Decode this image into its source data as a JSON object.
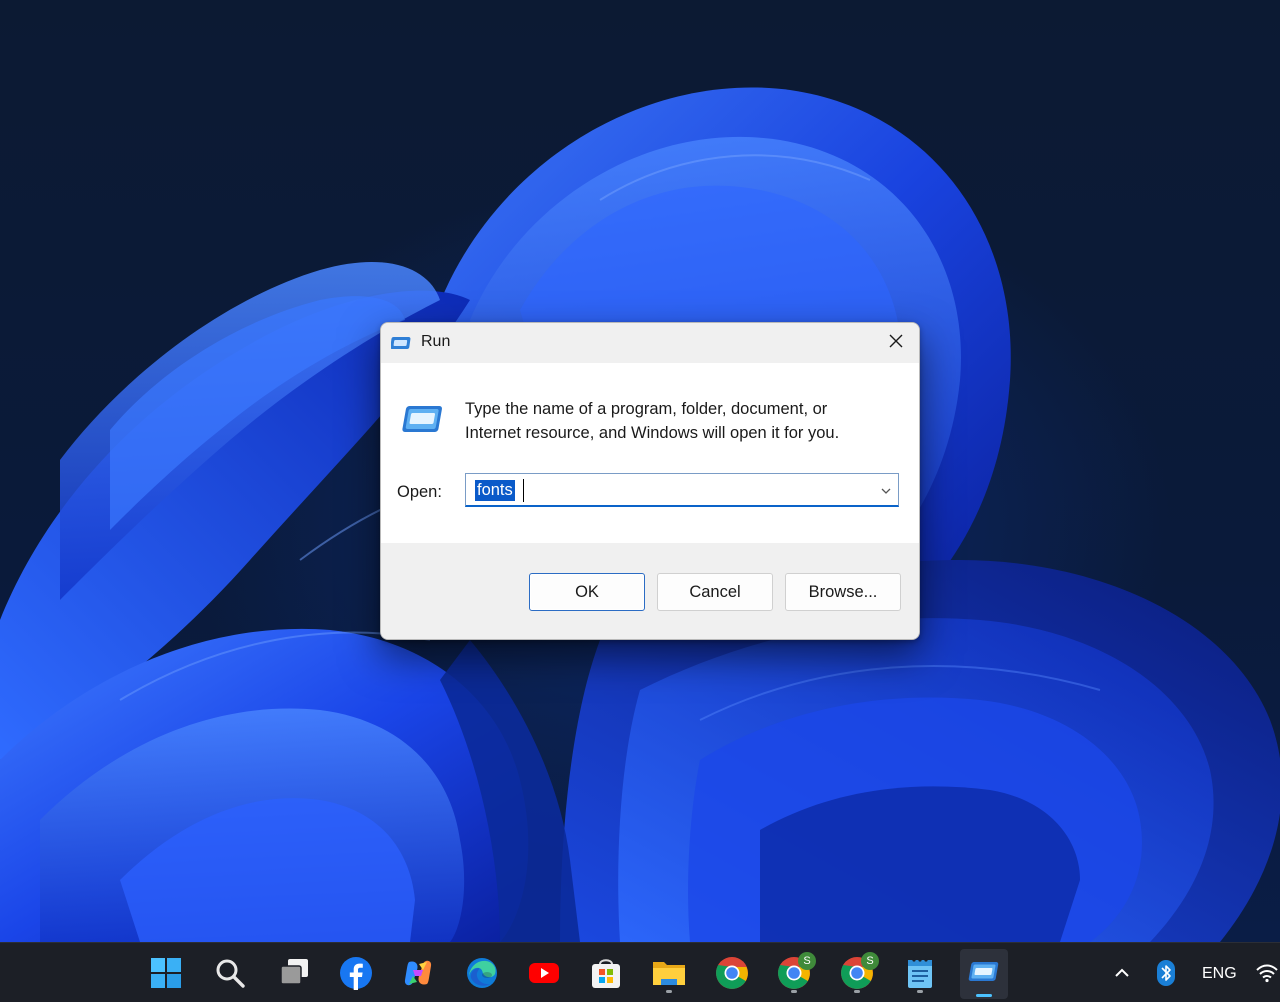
{
  "dialog": {
    "title": "Run",
    "description": "Type the name of a program, folder, document, or Internet resource, and Windows will open it for you.",
    "open_label": "Open:",
    "open_value": "fonts",
    "buttons": {
      "ok": "OK",
      "cancel": "Cancel",
      "browse": "Browse..."
    },
    "icons": {
      "title": "run-icon",
      "content": "run-icon",
      "close": "close-icon",
      "dropdown": "chevron-down-icon"
    }
  },
  "taskbar": {
    "apps": [
      {
        "name": "start",
        "icon": "windows-start-icon"
      },
      {
        "name": "search",
        "icon": "search-icon"
      },
      {
        "name": "task-view",
        "icon": "task-view-icon"
      },
      {
        "name": "facebook",
        "icon": "facebook-icon"
      },
      {
        "name": "copilot",
        "icon": "copilot-icon"
      },
      {
        "name": "edge",
        "icon": "edge-icon"
      },
      {
        "name": "youtube",
        "icon": "youtube-icon"
      },
      {
        "name": "store",
        "icon": "store-icon"
      },
      {
        "name": "file-explorer",
        "icon": "folder-icon"
      },
      {
        "name": "chrome",
        "icon": "chrome-icon"
      },
      {
        "name": "chrome-profile-1",
        "icon": "chrome-icon",
        "badge": "S"
      },
      {
        "name": "chrome-profile-2",
        "icon": "chrome-icon",
        "badge": "S"
      },
      {
        "name": "notepad",
        "icon": "notepad-icon"
      },
      {
        "name": "run",
        "icon": "run-icon",
        "active": true
      }
    ],
    "tray": {
      "language": "ENG",
      "icons": [
        "chevron-up-icon",
        "bluetooth-icon",
        "wifi-icon"
      ]
    },
    "accent": "#4cc2ff"
  },
  "colors": {
    "selection": "#0a5ac9",
    "wallpaper_blue": "#1f4fff"
  }
}
